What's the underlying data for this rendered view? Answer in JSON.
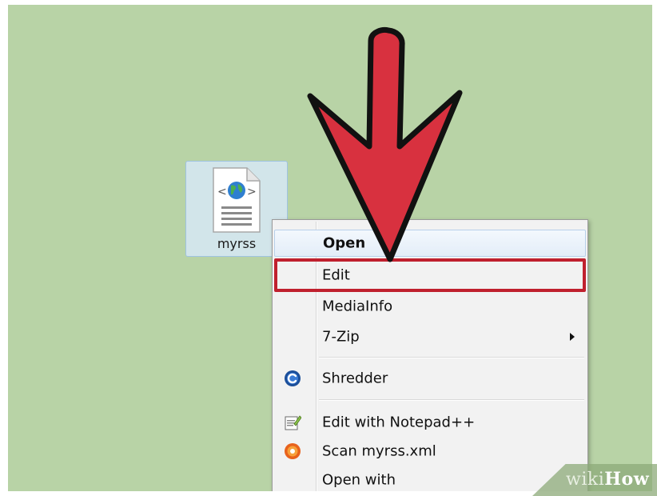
{
  "desktop": {
    "background_color": "#b8d3a6",
    "file": {
      "name": "myrss",
      "icon": "xml-document-globe-icon"
    }
  },
  "context_menu": {
    "items": [
      {
        "label": "Open",
        "default": true
      },
      {
        "label": "Edit",
        "highlighted": true,
        "highlight_color": "#c0202e"
      },
      {
        "label": "MediaInfo"
      },
      {
        "label": "7-Zip",
        "submenu": true
      },
      {
        "label": "Shredder",
        "icon": "shredder-icon"
      },
      {
        "label": "Edit with Notepad++",
        "icon": "notepad-plus-plus-icon"
      },
      {
        "label": "Scan myrss.xml",
        "icon": "antivirus-scan-icon"
      },
      {
        "label": "Open with"
      }
    ]
  },
  "annotation": {
    "type": "arrow",
    "direction": "down",
    "color": "#d8313f"
  },
  "watermark": {
    "prefix": "wiki",
    "suffix": "How"
  }
}
